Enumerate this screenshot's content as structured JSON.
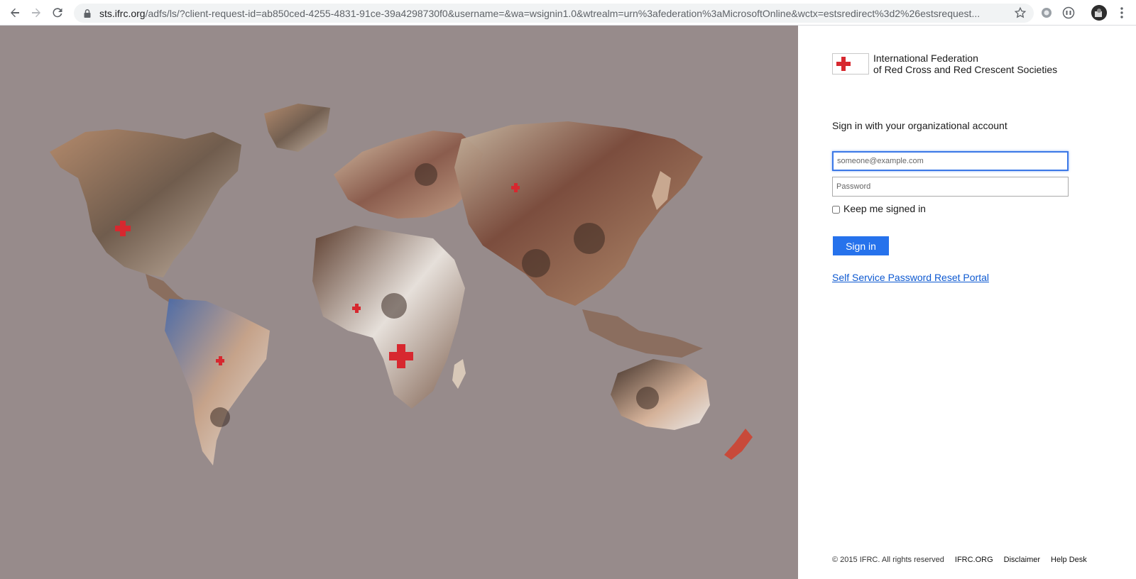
{
  "browser": {
    "url_host": "sts.ifrc.org",
    "url_path": "/adfs/ls/?client-request-id=ab850ced-4255-4831-91ce-39a4298730f0&username=&wa=wsignin1.0&wtrealm=urn%3afederation%3aMicrosoftOnline&wctx=estsredirect%3d2%26estsrequest...",
    "icons": [
      "back-icon",
      "forward-icon",
      "reload-icon",
      "lock-icon",
      "star-icon",
      "extension-icon",
      "extension-icon",
      "profile-avatar",
      "more-menu-icon"
    ]
  },
  "logo": {
    "line1": "International Federation",
    "line2": "of Red Cross and Red Crescent Societies",
    "red": "#d7282f"
  },
  "form": {
    "heading": "Sign in with your organizational account",
    "username_placeholder": "someone@example.com",
    "password_placeholder": "Password",
    "keep_signed_in": "Keep me signed in",
    "signin_label": "Sign in",
    "sspr_link": "Self Service Password Reset Portal"
  },
  "footer": {
    "copyright": "© 2015 IFRC. All rights reserved",
    "links": [
      "IFRC.ORG",
      "Disclaimer",
      "Help Desk"
    ]
  },
  "colors": {
    "illustration_bg": "#978b8b",
    "signin_button": "#2672ec",
    "link": "#0d59d1",
    "focus_border": "#3b78e7"
  }
}
